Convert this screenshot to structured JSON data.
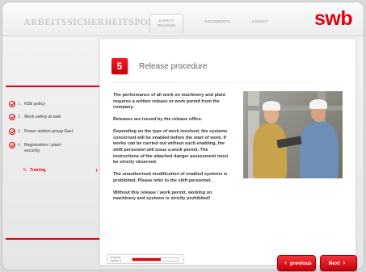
{
  "header": {
    "portal_title": "ARBEITSSICHERHEITSPORTAL",
    "tabs": [
      {
        "label_line1": "SAFETY",
        "label_line2": "TRAINING",
        "active": true
      },
      {
        "label": "DOCUMENTS",
        "active": false
      },
      {
        "label": "LOGOUT",
        "active": false
      }
    ],
    "logo": "swb"
  },
  "sidebar": {
    "items": [
      {
        "num": "1.",
        "label": "HSE policy",
        "completed": true
      },
      {
        "num": "2.",
        "label": "Work safety at swb",
        "completed": true
      },
      {
        "num": "3.",
        "label": "Power station group East",
        "completed": true
      },
      {
        "num": "4.",
        "label_line1": "Registration / plant",
        "label_line2": "security",
        "completed": true
      },
      {
        "num": "5.",
        "label": "Training",
        "active": true
      }
    ]
  },
  "main": {
    "chapter_number": "5",
    "title": "Release procedure",
    "paragraphs": [
      "The performance of all work on machinery and plant requires a written release or work permit from the company.",
      "Releases are issued by the release office.",
      "Depending on the type of work involved, the systems concerned will be enabled before the start of work. If works can be carried out without such enabling, the shift personnel will issue a work permit. The instructions of the attached danger assessment must be strictly observed.",
      "The unauthorised modification of enabled systems is prohibited. Please refer to the shift personnel.",
      "Without this release / work permit, working on machinery and systems is strictly prohibited!"
    ],
    "progress": {
      "label_line1": "progress",
      "label_line2": "chapter 5",
      "percent": 62
    }
  },
  "navigation": {
    "previous_label": "previous",
    "next_label": "Next"
  },
  "colors": {
    "brand_red": "#e3000f"
  }
}
